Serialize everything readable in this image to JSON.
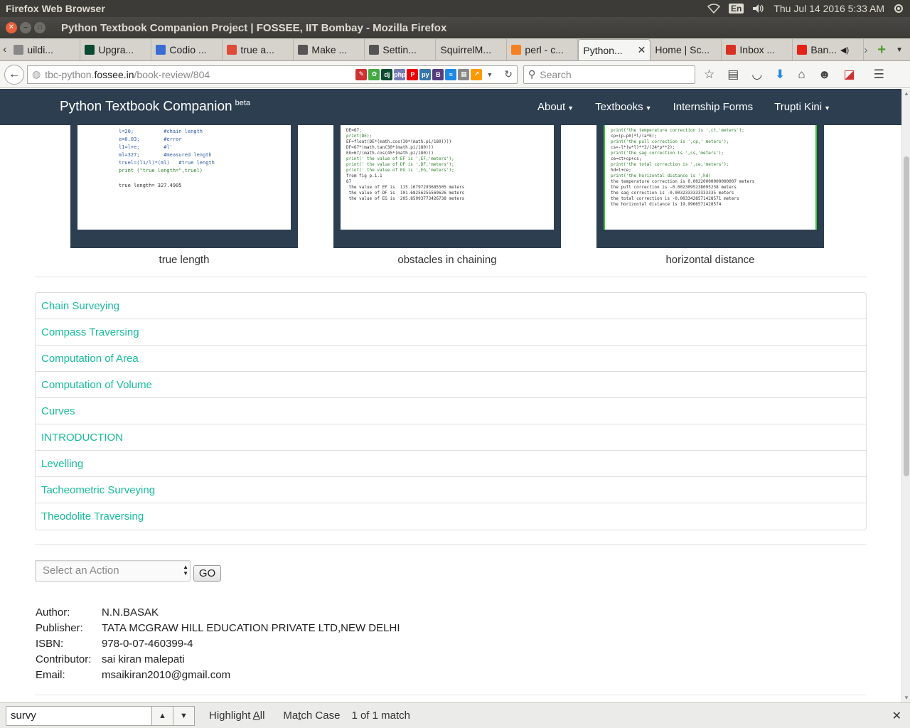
{
  "os": {
    "app_name": "Firefox Web Browser",
    "keyboard": "En",
    "datetime": "Thu Jul 14 2016  5:33 AM"
  },
  "window": {
    "title": "Python Textbook Companion Project | FOSSEE, IIT Bombay - Mozilla Firefox"
  },
  "tabs": [
    {
      "label": "uildi...",
      "icon": "page-icon",
      "color": "#888888"
    },
    {
      "label": "Upgra...",
      "icon": "dj-icon",
      "color": "#0c4b33"
    },
    {
      "label": "Codio ...",
      "icon": "codio-icon",
      "color": "#3b6cd4"
    },
    {
      "label": "true a...",
      "icon": "chrome-icon",
      "color": "#dd4b39"
    },
    {
      "label": "Make ...",
      "icon": "fossee-icon",
      "color": "#555555"
    },
    {
      "label": "Settin...",
      "icon": "fossee-icon",
      "color": "#555555"
    },
    {
      "label": "SquirrelM...",
      "icon": "none",
      "color": "#ffffff"
    },
    {
      "label": "perl - c...",
      "icon": "stackoverflow-icon",
      "color": "#f48024"
    },
    {
      "label": "Python...",
      "icon": "none",
      "color": "#ffffff",
      "active": true
    },
    {
      "label": "Home | Sc...",
      "icon": "none",
      "color": "#ffffff"
    },
    {
      "label": "Inbox ...",
      "icon": "gmail-icon",
      "color": "#d93025"
    },
    {
      "label": "Ban...",
      "icon": "youtube-icon",
      "color": "#e62117"
    }
  ],
  "nav": {
    "url_prefix": "tbc-python.",
    "url_domain": "fossee.in",
    "url_path": "/book-review/804",
    "search_placeholder": "Search"
  },
  "site": {
    "brand": "Python Textbook Companion",
    "brand_sup": "beta",
    "menu": [
      {
        "label": "About",
        "dropdown": true
      },
      {
        "label": "Textbooks",
        "dropdown": true
      },
      {
        "label": "Internship Forms",
        "dropdown": false
      },
      {
        "label": "Trupti Kini",
        "dropdown": true
      }
    ]
  },
  "cards": [
    {
      "caption": "true length",
      "code": [
        "l=20;          #chain length",
        "e=0.03;        #error",
        "l1=l+e;        #l'",
        "ml=327;        #measured length",
        "truel=(l1/l)*(ml)   #true length",
        "print (\"true length=\",truel)",
        "",
        "true length= 327.4905"
      ]
    },
    {
      "caption": "obstacles in chaining",
      "code": [
        "DE=67;",
        "print(DE);",
        "EF=float(DE*(math.cos(30*(math.pi/180))))",
        "DF=67*(math.tan(30*(math.pi/180)))",
        "EG=67/(math.cos(45*(math.pi/180)))",
        "print(' the value of EF is ',EF,'meters');",
        "print(' the value of DF is ',DF,'meters');",
        "print(' the value of EG is ',EG,'meters');",
        "from fig p.1.1",
        "67",
        " the value of EF is  115.16797293685505 meters",
        " the value of DF is  101.68256255569626 meters",
        " the value of EG is  205.85993773426738 meters"
      ]
    },
    {
      "caption": "horizontal distance",
      "code": [
        "print('the temperature correction is ',ct,'meters');",
        "cp=(p-p0)*l/(a*E);",
        "print('the pull correction is ',cp,' meters');",
        "cs=-l*(w*l)**2/(24*p**2);",
        "print('the sag correction is ',cs,'meters');",
        "ce=ct+cp+cs;",
        "print('the total correction is ',ce,'meters');",
        "hd=l+ce;",
        "print('the horizontal distance is ',hd)",
        "the temperature correction is 0.00220000000000007 meters",
        "the pull correction is -0.0023095238095238 meters",
        "the sag correction is -0.0032333333333335 meters",
        "the total correction is -0.0033428571428571 meters",
        "the horizontal distance is 19.9966571428574"
      ]
    }
  ],
  "chapters": [
    "Chain Surveying",
    "Compass Traversing",
    "Computation of Area",
    "Computation of Volume",
    "Curves",
    "INTRODUCTION",
    "Levelling",
    "Tacheometric Surveying",
    "Theodolite Traversing"
  ],
  "action": {
    "select_placeholder": "Select an Action",
    "go_label": "GO"
  },
  "book_info": [
    {
      "key": "Author:",
      "value": "N.N.BASAK"
    },
    {
      "key": "Publisher:",
      "value": "TATA MCGRAW HILL EDUCATION PRIVATE LTD,NEW DELHI"
    },
    {
      "key": "ISBN:",
      "value": "978-0-07-460399-4"
    },
    {
      "key": "Contributor:",
      "value": "sai kiran malepati"
    },
    {
      "key": "Email:",
      "value": "msaikiran2010@gmail.com"
    }
  ],
  "findbar": {
    "query": "survy",
    "highlight_all_pre": "Highlight ",
    "highlight_all_key": "A",
    "highlight_all_post": "ll",
    "match_case_pre": "Ma",
    "match_case_key": "t",
    "match_case_post": "ch Case",
    "result": "1 of 1 match"
  },
  "colors": {
    "site_nav_bg": "#2c3e50",
    "link": "#18bc9c"
  }
}
